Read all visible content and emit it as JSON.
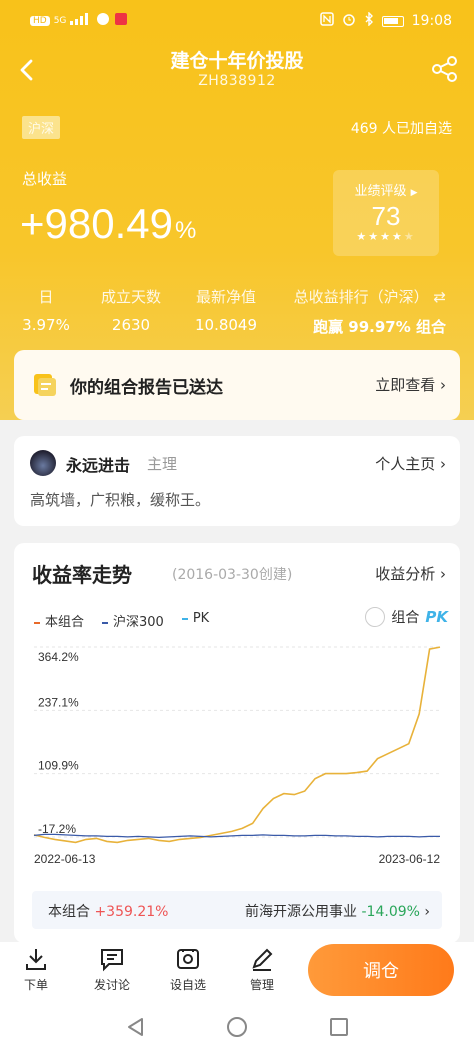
{
  "status": {
    "time": "19:08",
    "left_tags": [
      "HD",
      "5G"
    ]
  },
  "nav": {
    "title": "建仓十年价投股",
    "code": "ZH838912"
  },
  "hero": {
    "market_tag": "沪深",
    "follow_count": "469 人已加自选",
    "total_label": "总收益",
    "total_value": "+980.49",
    "total_unit": "%",
    "rating_label": "业绩评级",
    "rating_score": "73",
    "rating_stars": 4
  },
  "stats": {
    "day_label": "日",
    "day_value": "3.97%",
    "days_label": "成立天数",
    "days_value": "2630",
    "nav_label": "最新净值",
    "nav_value": "10.8049",
    "rank_label": "总收益排行（沪深）",
    "rank_value": "跑赢 99.97% 组合"
  },
  "report": {
    "text": "你的组合报告已送达",
    "link": "立即查看"
  },
  "owner": {
    "name": "永远进击",
    "role": "主理",
    "link": "个人主页",
    "bio": "高筑墙，广积粮，缓称王。"
  },
  "chart_section": {
    "title": "收益率走势",
    "created": "(2016-03-30创建)",
    "link": "收益分析",
    "legend": [
      "本组合",
      "沪深300",
      "PK"
    ],
    "pk_toggle": "组合",
    "pk_logo": "PK"
  },
  "chart_data": {
    "type": "line",
    "x_start": "2022-06-13",
    "x_end": "2023-06-12",
    "y_ticks": [
      "364.2%",
      "237.1%",
      "109.9%",
      "-17.2%"
    ],
    "ylim": [
      -17.2,
      364.2
    ],
    "series": [
      {
        "name": "本组合",
        "color": "#e8b23a",
        "values": [
          -13,
          -18,
          -22,
          -25,
          -28,
          -22,
          -20,
          -26,
          -28,
          -24,
          -22,
          -20,
          -24,
          -26,
          -22,
          -20,
          -18,
          -14,
          -10,
          -6,
          0,
          10,
          40,
          60,
          70,
          68,
          75,
          100,
          110,
          110,
          110,
          112,
          115,
          140,
          150,
          160,
          170,
          230,
          360,
          364
        ]
      },
      {
        "name": "沪深300",
        "color": "#3a5aa8",
        "values": [
          -14,
          -12,
          -12,
          -13,
          -14,
          -15,
          -15,
          -16,
          -16,
          -17,
          -16,
          -17,
          -18,
          -17,
          -16,
          -15,
          -16,
          -17,
          -16,
          -15,
          -14,
          -14,
          -13,
          -14,
          -14,
          -15,
          -15,
          -14,
          -14,
          -15,
          -15,
          -16,
          -16,
          -17,
          -16,
          -16,
          -16,
          -17,
          -16,
          -16
        ]
      }
    ]
  },
  "compare": {
    "a_label": "本组合",
    "a_value": "+359.21%",
    "b_label": "前海开源公用事业",
    "b_value": "-14.09%"
  },
  "tabbar": {
    "order": "下单",
    "discuss": "发讨论",
    "watch": "设自选",
    "manage": "管理",
    "adjust": "调仓"
  }
}
